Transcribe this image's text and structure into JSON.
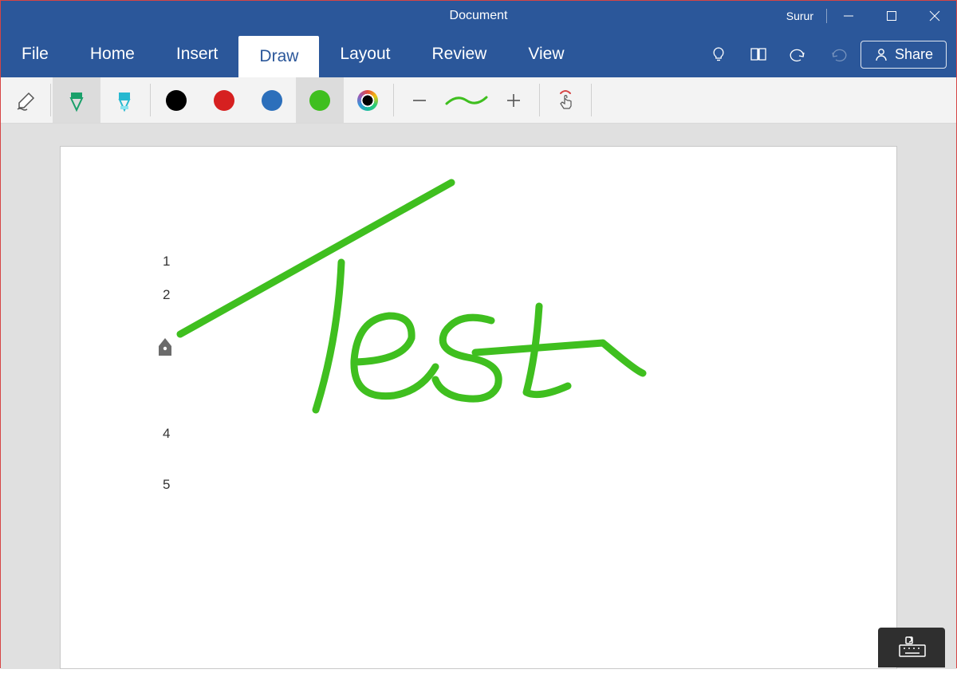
{
  "titlebar": {
    "document_title": "Document",
    "user": "Surur"
  },
  "tabs": [
    {
      "label": "File"
    },
    {
      "label": "Home"
    },
    {
      "label": "Insert"
    },
    {
      "label": "Draw",
      "active": true
    },
    {
      "label": "Layout"
    },
    {
      "label": "Review"
    },
    {
      "label": "View"
    }
  ],
  "ribbon_right": {
    "share_label": "Share"
  },
  "toolbar": {
    "icons": {
      "eraser": "eraser-icon",
      "pen": "pen-icon",
      "highlighter": "highlighter-icon",
      "minus": "minus-icon",
      "plus": "plus-icon",
      "stroke": "stroke-sample",
      "touch": "touch-draw-icon"
    },
    "colors": {
      "black": "#000000",
      "red": "#d62020",
      "blue": "#2c6fbb",
      "green": "#3fbf1f",
      "selected": "green"
    }
  },
  "document": {
    "line_numbers": [
      "1",
      "2",
      "4",
      "5"
    ],
    "ink_text": "Test",
    "ink_color": "#3fbf1f"
  }
}
